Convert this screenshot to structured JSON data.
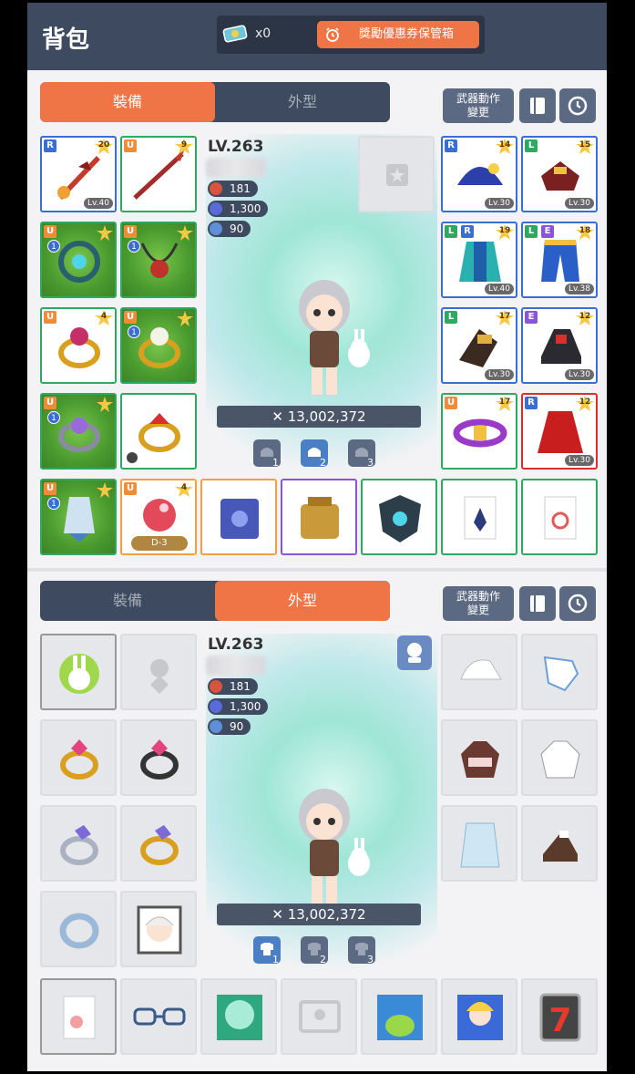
{
  "header": {
    "title": "背包",
    "coupon_count": "x0",
    "box_button": "獎勵優惠券保管箱"
  },
  "equipment_panel": {
    "tabs": [
      {
        "label": "裝備",
        "active": true
      },
      {
        "label": "外型",
        "active": false
      }
    ],
    "weapon_motion": "武器動作\n變更",
    "level": "LV.263",
    "stats": [
      "181",
      "1,300",
      "90"
    ],
    "combat_power": "13,002,372",
    "presets": [
      "1",
      "2",
      "3"
    ],
    "active_preset": 2,
    "left_slots": [
      {
        "grade": "R",
        "star": "20",
        "level": "Lv.40",
        "icon": "sword-icon"
      },
      {
        "grade": "U",
        "star": "9",
        "icon": "spear-icon"
      },
      {
        "grade": "U",
        "icon": "pendant-icon"
      },
      {
        "grade": "U",
        "icon": "necklace-icon"
      },
      {
        "grade": "U",
        "star": "4",
        "icon": "ring-icon"
      },
      {
        "grade": "U",
        "icon": "ring-icon"
      },
      {
        "grade": "U",
        "icon": "ring-icon"
      },
      {
        "icon": "ring-icon"
      },
      {
        "grade": "U",
        "icon": "earring-icon"
      },
      {
        "grade": "U",
        "star": "4",
        "badge": "D-3",
        "icon": "gem-icon"
      }
    ],
    "right_slots": [
      {
        "grade": "R",
        "star": "14",
        "level": "Lv.30",
        "icon": "hat-icon"
      },
      {
        "grade": "L",
        "star": "15",
        "level": "Lv.30",
        "icon": "top-icon"
      },
      {
        "grade": "L",
        "grade2": "R",
        "star": "19",
        "level": "Lv.40",
        "icon": "cape-icon"
      },
      {
        "grade": "L",
        "grade2": "E",
        "star": "18",
        "level": "Lv.38",
        "icon": "pants-icon"
      },
      {
        "grade": "L",
        "star": "17",
        "level": "Lv.30",
        "icon": "gloves-icon"
      },
      {
        "grade": "E",
        "star": "12",
        "level": "Lv.30",
        "icon": "shoes-icon"
      },
      {
        "grade": "U",
        "star": "17",
        "icon": "belt-icon"
      },
      {
        "grade": "R",
        "star": "12",
        "level": "Lv.30",
        "icon": "cloak-icon"
      }
    ],
    "bottom_row": [
      "book-icon",
      "pocket-icon",
      "emblem-icon",
      "badge-icon",
      "medal-icon"
    ]
  },
  "cosmetic_panel": {
    "tabs": [
      {
        "label": "裝備",
        "active": false
      },
      {
        "label": "外型",
        "active": true
      }
    ],
    "weapon_motion": "武器動作\n變更",
    "level": "LV.263",
    "stats": [
      "181",
      "1,300",
      "90"
    ],
    "combat_power": "13,002,372",
    "presets": [
      "1",
      "2",
      "3"
    ],
    "active_preset": 1
  },
  "colors": {
    "header_bg": "#3d4a5f",
    "accent": "#ef7446",
    "rare": "#3b6ed1",
    "unique": "#ef8c3a",
    "legendary": "#2fa860",
    "epic": "#8a55d6"
  }
}
